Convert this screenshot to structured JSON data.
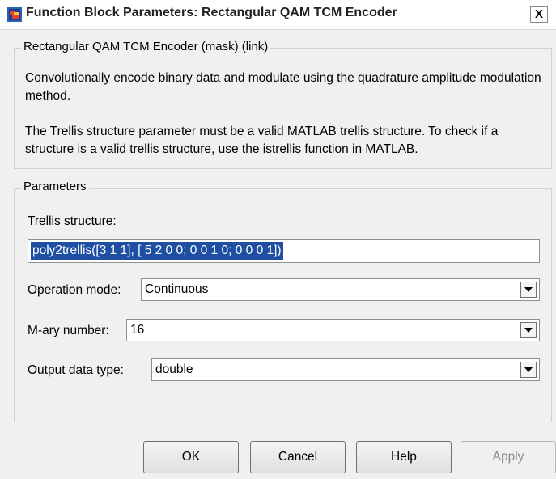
{
  "window": {
    "title": "Function Block Parameters: Rectangular QAM TCM Encoder",
    "close_label": "X"
  },
  "mask": {
    "legend": "Rectangular QAM TCM Encoder (mask) (link)",
    "description_1": "Convolutionally encode binary data and modulate using the quadrature amplitude modulation method.",
    "description_2": "The Trellis structure parameter must be a valid MATLAB trellis structure. To check if a structure is a valid trellis structure, use the istrellis function in MATLAB."
  },
  "parameters": {
    "legend": "Parameters",
    "trellis_label": "Trellis structure:",
    "trellis_value": "poly2trellis([3 1 1], [ 5 2 0 0; 0 0 1 0; 0 0 0 1])",
    "operation_mode_label": "Operation mode:",
    "operation_mode_value": "Continuous",
    "mary_label": "M-ary number:",
    "mary_value": "16",
    "output_type_label": "Output data type:",
    "output_type_value": "double"
  },
  "buttons": {
    "ok": "OK",
    "cancel": "Cancel",
    "help": "Help",
    "apply": "Apply"
  }
}
